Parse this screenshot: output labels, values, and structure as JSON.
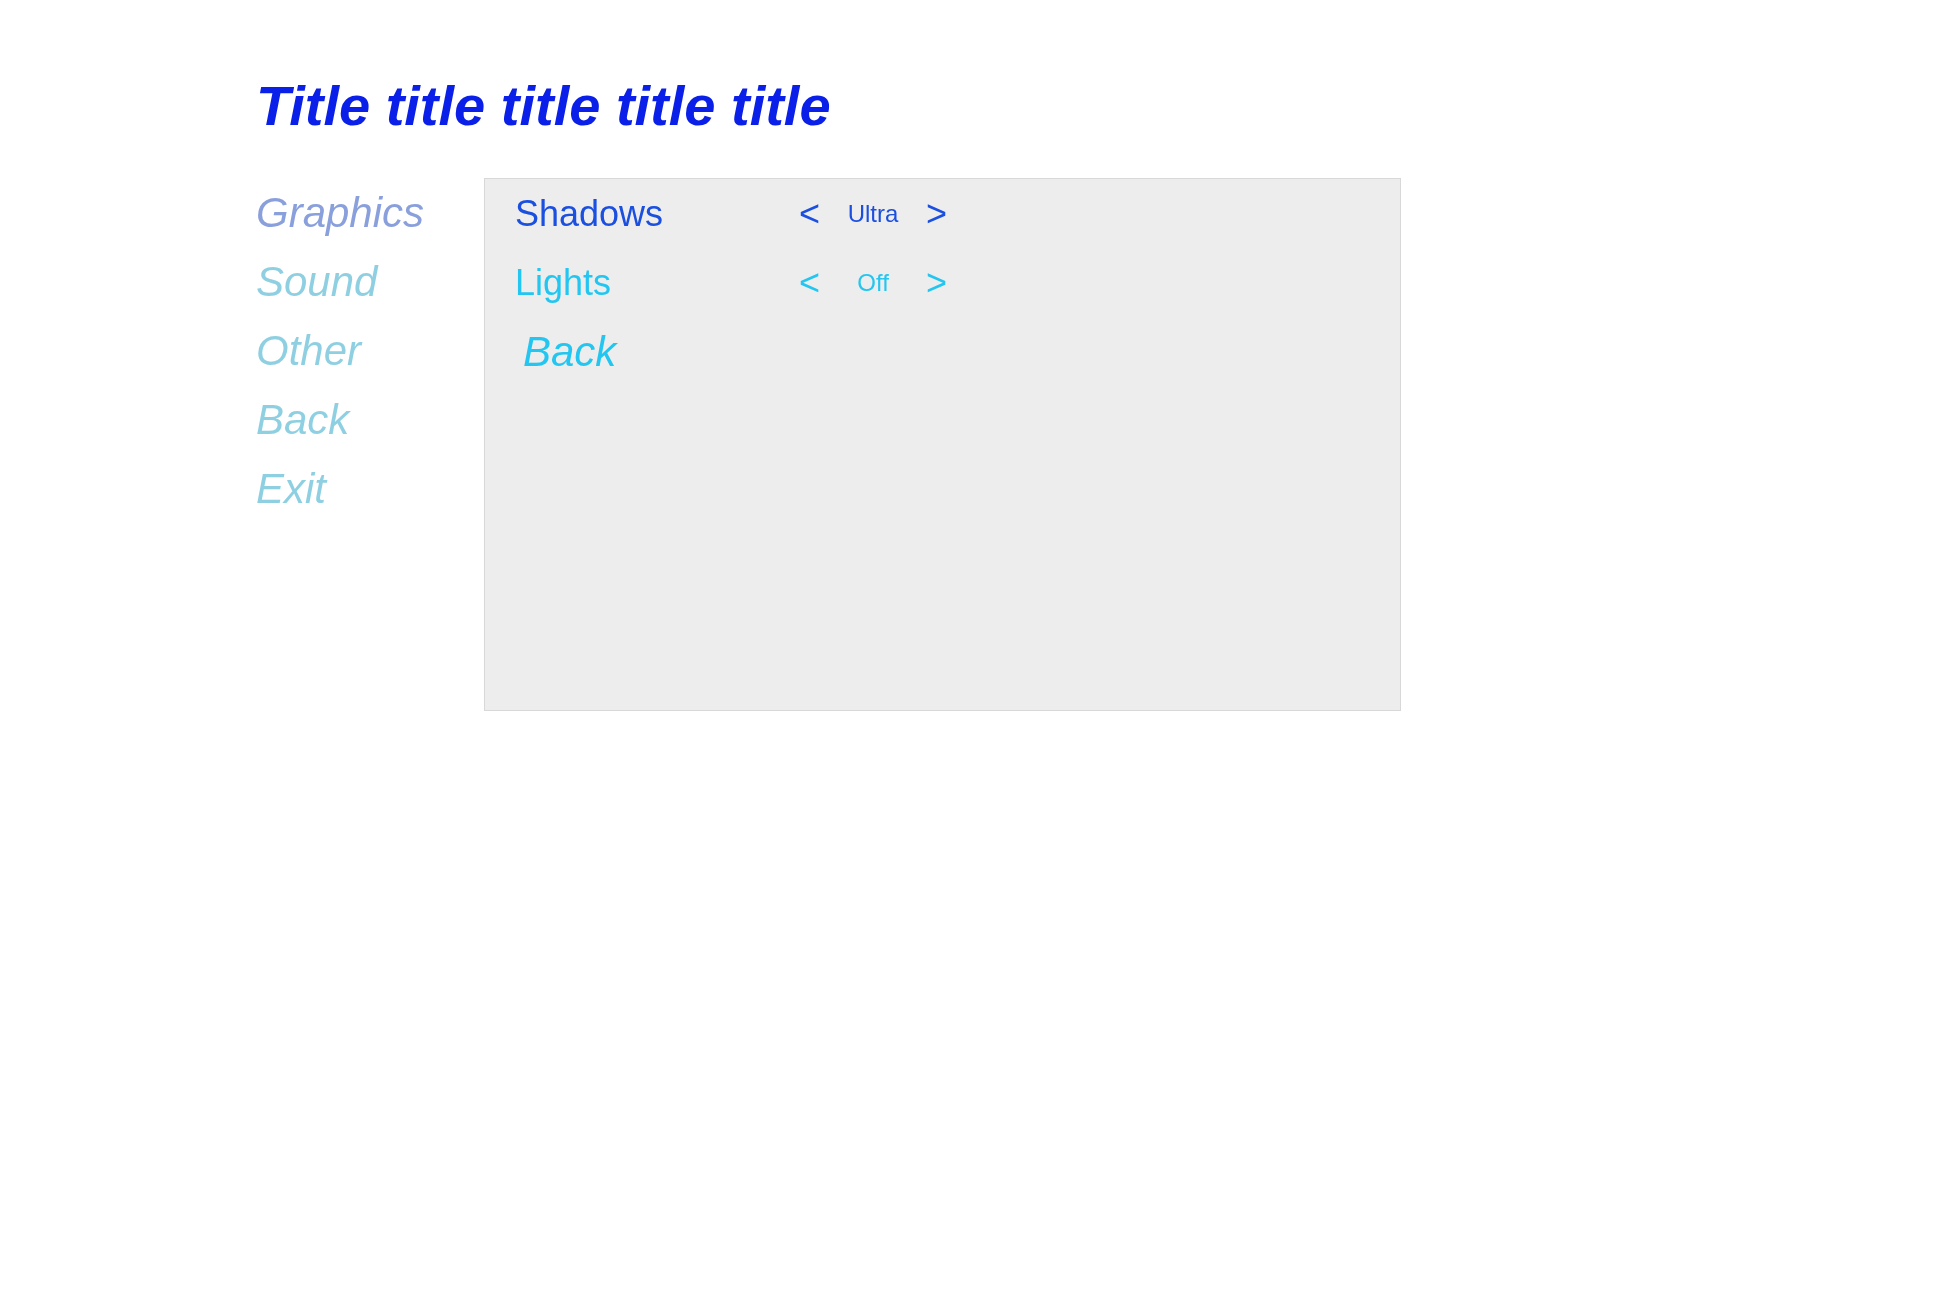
{
  "title": "Title title title title title",
  "menu": [
    {
      "label": "Graphics",
      "selected": true
    },
    {
      "label": "Sound",
      "selected": false
    },
    {
      "label": "Other",
      "selected": false
    },
    {
      "label": "Back",
      "selected": false
    },
    {
      "label": "Exit",
      "selected": false
    }
  ],
  "settings": [
    {
      "name": "Shadows",
      "prev": "<",
      "value": "Ultra",
      "next": ">",
      "selected": true
    },
    {
      "name": "Lights",
      "prev": "<",
      "value": "Off",
      "next": ">",
      "selected": false
    }
  ],
  "back": {
    "label": "Back",
    "selected": false
  }
}
